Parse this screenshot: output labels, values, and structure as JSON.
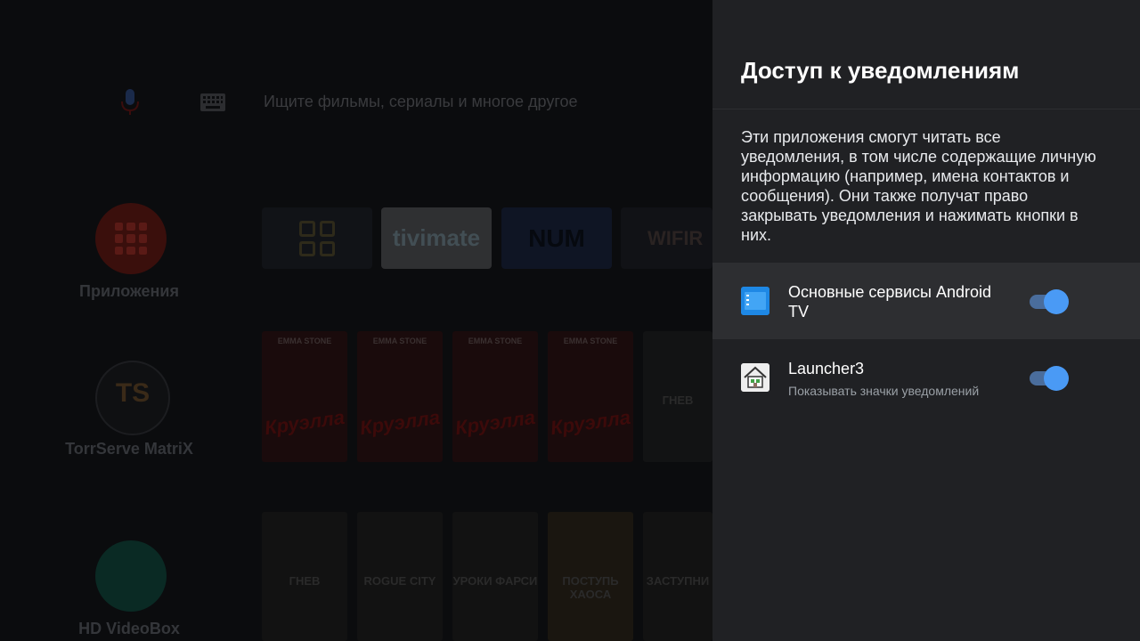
{
  "launcher": {
    "search_placeholder": "Ищите фильмы, сериалы и многое другое",
    "side_items": [
      {
        "label": "Приложения"
      },
      {
        "label": "TorrServe MatriX",
        "glyph": "TS"
      },
      {
        "label": "HD VideoBox"
      }
    ],
    "app_tiles": [
      {
        "name": "apps-grid"
      },
      {
        "label": "tivimate"
      },
      {
        "label": "NUM"
      },
      {
        "label": "WIFIR"
      }
    ],
    "row1_posters": [
      {
        "top": "EMMA STONE",
        "title": "Круэлла"
      },
      {
        "top": "EMMA STONE",
        "title": "Круэлла"
      },
      {
        "top": "EMMA STONE",
        "title": "Круэлла"
      },
      {
        "top": "EMMA STONE",
        "title": "Круэлла"
      },
      {
        "top": "",
        "title": "ГНЕВ"
      }
    ],
    "row2_posters": [
      {
        "title": "ГНЕВ"
      },
      {
        "title": "ROGUE CITY"
      },
      {
        "title": "УРОКИ ФАРСИ"
      },
      {
        "title": "ПОСТУПЬ ХАОСА"
      },
      {
        "title": "ЗАСТУПНИ"
      }
    ]
  },
  "panel": {
    "title": "Доступ к уведомлениям",
    "description": "Эти приложения смогут читать все уведомления, в том числе содержащие личную информацию (например, имена контактов и сообщения). Они также получат право закрывать уведомления и нажимать кнопки в них.",
    "items": [
      {
        "name": "Основные сервисы Android TV",
        "subtitle": "",
        "enabled": true,
        "icon": "android-tv-services-icon"
      },
      {
        "name": "Launcher3",
        "subtitle": "Показывать значки уведомлений",
        "enabled": true,
        "icon": "launcher-home-icon"
      }
    ]
  },
  "colors": {
    "panel_bg": "#202124",
    "toggle_on": "#4a9af5",
    "toggle_track": "#4a6d9c"
  }
}
